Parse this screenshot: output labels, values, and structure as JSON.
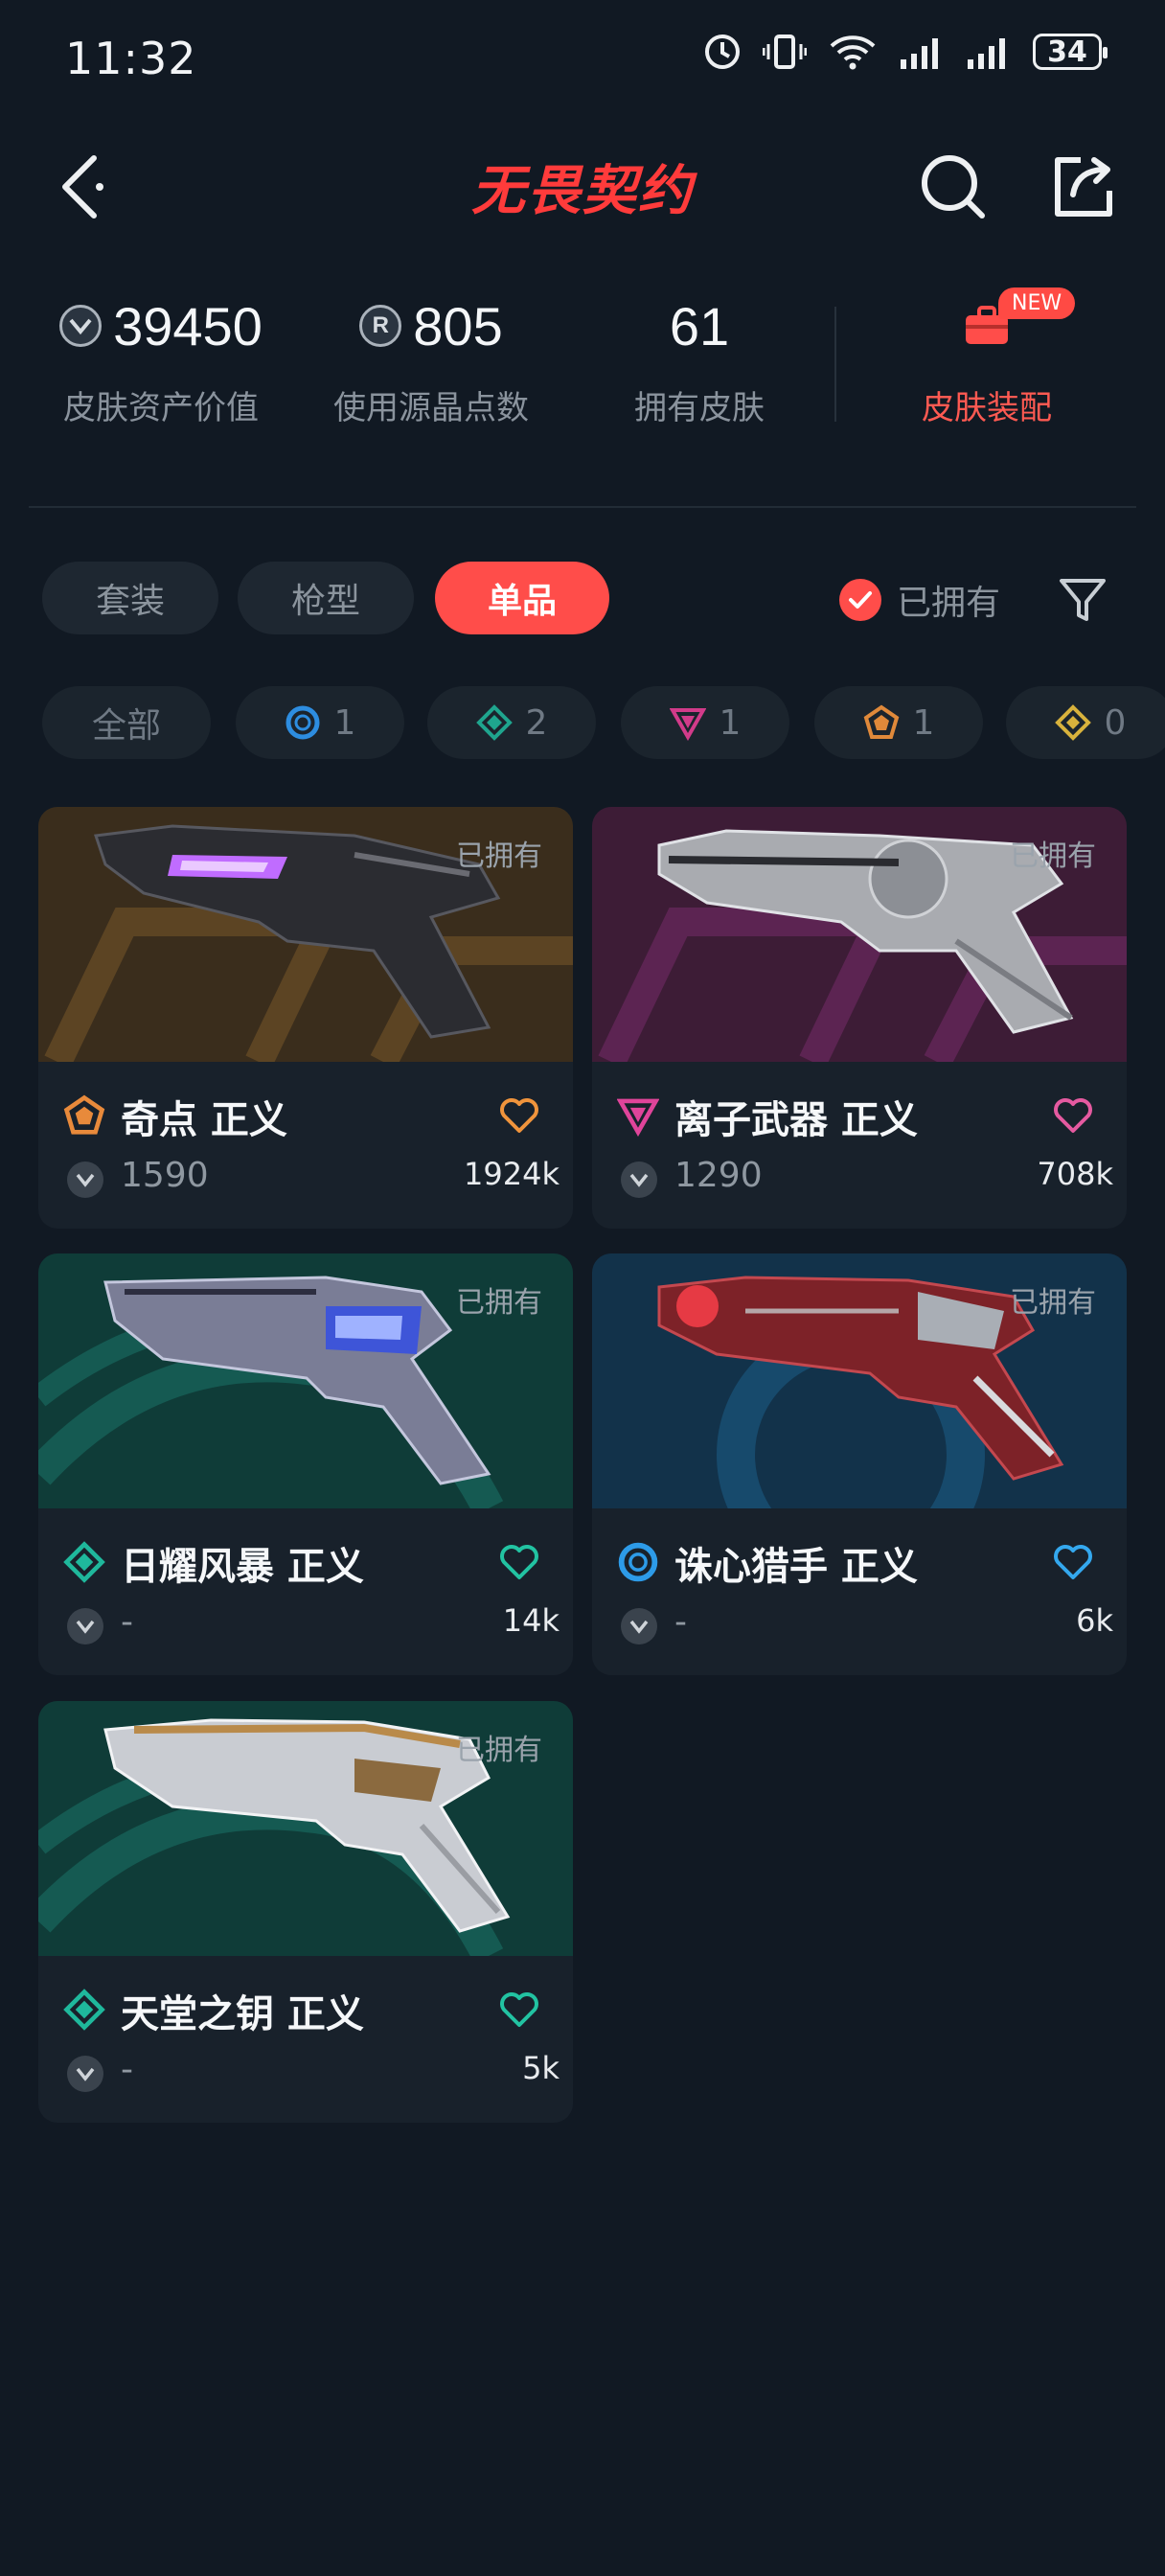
{
  "status": {
    "time": "11:32",
    "battery": "34"
  },
  "header": {
    "logo_text": "无畏契约"
  },
  "stats": [
    {
      "value": "39450",
      "label": "皮肤资产价值",
      "icon": "vp-coin-icon"
    },
    {
      "value": "805",
      "label": "使用源晶点数",
      "icon": "radianite-icon"
    },
    {
      "value": "61",
      "label": "拥有皮肤",
      "icon": ""
    }
  ],
  "skin_config": {
    "label": "皮肤装配",
    "badge": "NEW"
  },
  "tabs": [
    {
      "label": "套装",
      "active": false
    },
    {
      "label": "枪型",
      "active": false
    },
    {
      "label": "单品",
      "active": true
    }
  ],
  "owned_filter": {
    "label": "已拥有",
    "checked": true
  },
  "rarity_filters": [
    {
      "label": "全部",
      "icon": ""
    },
    {
      "label": "1",
      "icon": "rarity-blue-icon",
      "color": "#2d8de0"
    },
    {
      "label": "2",
      "icon": "rarity-teal-icon",
      "color": "#1fa58e"
    },
    {
      "label": "1",
      "icon": "rarity-pink-icon",
      "color": "#d23b8a"
    },
    {
      "label": "1",
      "icon": "rarity-orange-icon",
      "color": "#e0893a"
    },
    {
      "label": "0",
      "icon": "rarity-gold-icon",
      "color": "#d8b23c"
    }
  ],
  "cards": [
    {
      "name": "奇点 正义",
      "tag": "已拥有",
      "price": "1590",
      "likes": "1924k",
      "rarity_color": "#e88a3b",
      "heart_color": "#f0943c",
      "bg": "#3a2d1c",
      "bg2": "#5a4020"
    },
    {
      "name": "离子武器 正义",
      "tag": "已拥有",
      "price": "1290",
      "likes": "708k",
      "rarity_color": "#e0449a",
      "heart_color": "#e55aa0",
      "bg": "#3d1c36",
      "bg2": "#5a2050"
    },
    {
      "name": "日耀风暴 正义",
      "tag": "已拥有",
      "price": "-",
      "likes": "14k",
      "rarity_color": "#1fb89c",
      "heart_color": "#22c3a2",
      "bg": "#0f3c38",
      "bg2": "#135a50"
    },
    {
      "name": "诛心猎手 正义",
      "tag": "已拥有",
      "price": "-",
      "likes": "6k",
      "rarity_color": "#2d9be8",
      "heart_color": "#34a8ee",
      "bg": "#12324a",
      "bg2": "#174868"
    },
    {
      "name": "天堂之钥 正义",
      "tag": "已拥有",
      "price": "-",
      "likes": "5k",
      "rarity_color": "#1fb89c",
      "heart_color": "#22c3a2",
      "bg": "#0f3c38",
      "bg2": "#135a50"
    }
  ]
}
